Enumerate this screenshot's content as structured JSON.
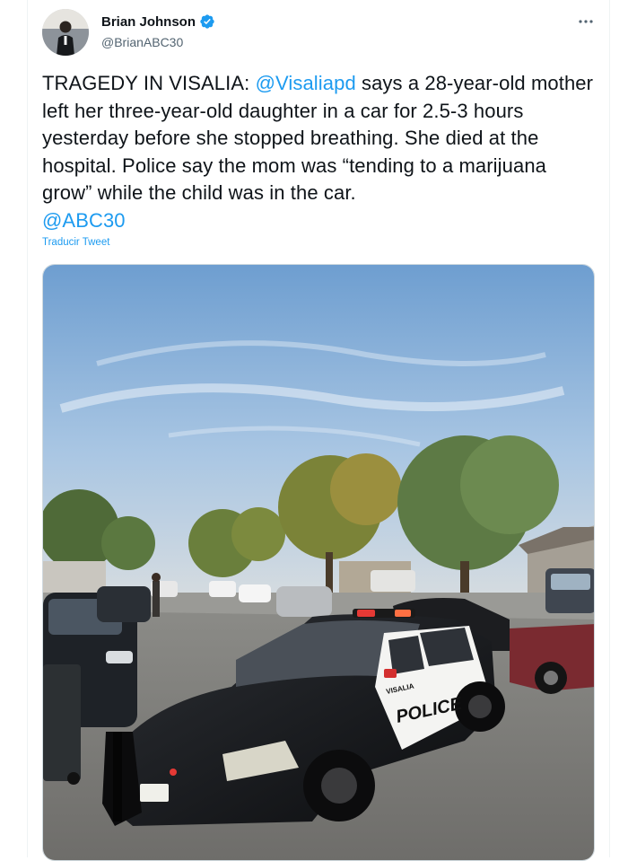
{
  "tweet": {
    "author": {
      "display_name": "Brian Johnson",
      "handle": "@BrianABC30",
      "verified": true
    },
    "text": {
      "prefix": "TRAGEDY IN VISALIA: ",
      "mention_1": "@Visaliapd",
      "body": " says a 28-year-old mother left her three-year-old daughter in a car for 2.5-3 hours yesterday before she stopped breathing. She died at the hospital. Police say the mom was “tending to a marijuana grow” while the child was in the car.",
      "mention_2": "@ABC30"
    },
    "translate_label": "Traducir Tweet",
    "media": {
      "police_door_label": "POLICE",
      "city_label": "VISALIA"
    }
  },
  "icons": {
    "verified": "verified-badge-icon",
    "more": "more-options-icon"
  },
  "colors": {
    "accent": "#1d9bf0",
    "text": "#0f1419",
    "secondary": "#536471"
  }
}
